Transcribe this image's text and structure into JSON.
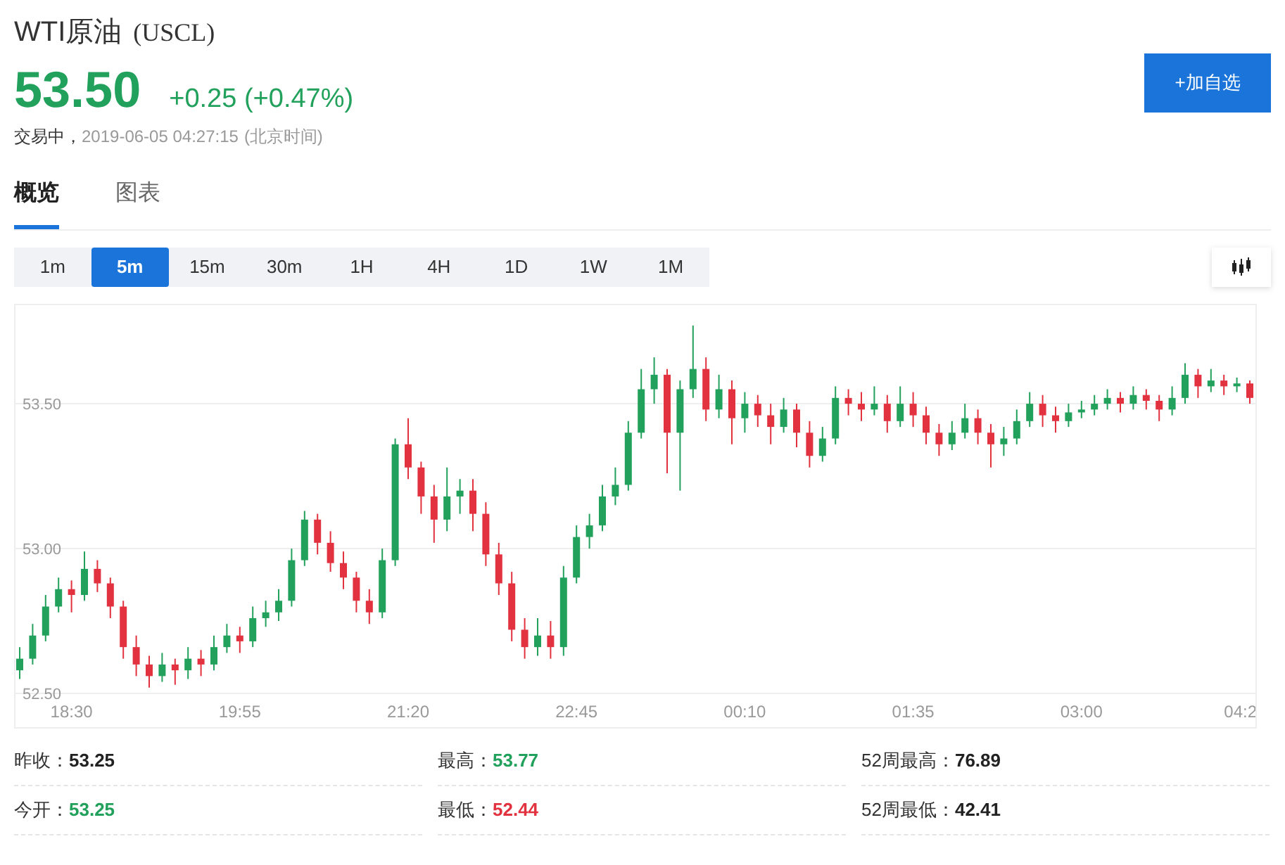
{
  "header": {
    "name": "WTI原油",
    "symbol": "(USCL)",
    "price": "53.50",
    "change": "+0.25 (+0.47%)",
    "color": "#21a15b",
    "status": "交易中，",
    "timestamp": "2019-06-05 04:27:15",
    "timezone": "(北京时间)"
  },
  "watch_button": "+加自选",
  "tabs": [
    {
      "label": "概览",
      "selected": true
    },
    {
      "label": "图表",
      "selected": false
    }
  ],
  "intervals": [
    {
      "label": "1m",
      "selected": false
    },
    {
      "label": "5m",
      "selected": true
    },
    {
      "label": "15m",
      "selected": false
    },
    {
      "label": "30m",
      "selected": false
    },
    {
      "label": "1H",
      "selected": false
    },
    {
      "label": "4H",
      "selected": false
    },
    {
      "label": "1D",
      "selected": false
    },
    {
      "label": "1W",
      "selected": false
    },
    {
      "label": "1M",
      "selected": false
    }
  ],
  "chart": {
    "chart_data": {
      "type": "candlestick",
      "categories": [
        null,
        null,
        null,
        null,
        "18:30",
        null,
        null,
        null,
        null,
        null,
        null,
        null,
        null,
        null,
        null,
        null,
        null,
        "19:55",
        null,
        null,
        null,
        null,
        null,
        null,
        null,
        null,
        null,
        null,
        null,
        null,
        "21:20",
        null,
        null,
        null,
        null,
        null,
        null,
        null,
        null,
        null,
        null,
        null,
        null,
        "22:45",
        null,
        null,
        null,
        null,
        null,
        null,
        null,
        null,
        null,
        null,
        null,
        null,
        "00:10",
        null,
        null,
        null,
        null,
        null,
        null,
        null,
        null,
        null,
        null,
        null,
        null,
        "01:35",
        null,
        null,
        null,
        null,
        null,
        null,
        null,
        null,
        null,
        null,
        null,
        null,
        "03:00",
        null,
        null,
        null,
        null,
        null,
        null,
        null,
        null,
        null,
        null,
        null,
        null,
        "04:2"
      ],
      "ohlc": [
        [
          52.58,
          52.66,
          52.55,
          52.62
        ],
        [
          52.62,
          52.74,
          52.6,
          52.7
        ],
        [
          52.7,
          52.84,
          52.68,
          52.8
        ],
        [
          52.8,
          52.9,
          52.78,
          52.86
        ],
        [
          52.86,
          52.89,
          52.78,
          52.84
        ],
        [
          52.84,
          52.99,
          52.82,
          52.93
        ],
        [
          52.93,
          52.96,
          52.85,
          52.88
        ],
        [
          52.88,
          52.9,
          52.76,
          52.8
        ],
        [
          52.8,
          52.82,
          52.62,
          52.66
        ],
        [
          52.66,
          52.7,
          52.56,
          52.6
        ],
        [
          52.6,
          52.63,
          52.52,
          52.56
        ],
        [
          52.56,
          52.64,
          52.54,
          52.6
        ],
        [
          52.6,
          52.62,
          52.53,
          52.58
        ],
        [
          52.58,
          52.66,
          52.55,
          52.62
        ],
        [
          52.62,
          52.65,
          52.56,
          52.6
        ],
        [
          52.6,
          52.7,
          52.58,
          52.66
        ],
        [
          52.66,
          52.74,
          52.64,
          52.7
        ],
        [
          52.7,
          52.73,
          52.64,
          52.68
        ],
        [
          52.68,
          52.8,
          52.66,
          52.76
        ],
        [
          52.76,
          52.82,
          52.73,
          52.78
        ],
        [
          52.78,
          52.86,
          52.75,
          52.82
        ],
        [
          52.82,
          53.0,
          52.8,
          52.96
        ],
        [
          52.96,
          53.13,
          52.94,
          53.1
        ],
        [
          53.1,
          53.12,
          52.98,
          53.02
        ],
        [
          53.02,
          53.06,
          52.92,
          52.95
        ],
        [
          52.95,
          52.99,
          52.86,
          52.9
        ],
        [
          52.9,
          52.92,
          52.78,
          52.82
        ],
        [
          52.82,
          52.86,
          52.74,
          52.78
        ],
        [
          52.78,
          53.0,
          52.76,
          52.96
        ],
        [
          52.96,
          53.38,
          52.94,
          53.36
        ],
        [
          53.36,
          53.45,
          53.24,
          53.28
        ],
        [
          53.28,
          53.3,
          53.12,
          53.18
        ],
        [
          53.18,
          53.22,
          53.02,
          53.1
        ],
        [
          53.1,
          53.28,
          53.06,
          53.18
        ],
        [
          53.18,
          53.24,
          53.12,
          53.2
        ],
        [
          53.2,
          53.24,
          53.06,
          53.12
        ],
        [
          53.12,
          53.16,
          52.94,
          52.98
        ],
        [
          52.98,
          53.02,
          52.84,
          52.88
        ],
        [
          52.88,
          52.92,
          52.68,
          52.72
        ],
        [
          52.72,
          52.76,
          52.62,
          52.66
        ],
        [
          52.66,
          52.76,
          52.63,
          52.7
        ],
        [
          52.7,
          52.75,
          52.62,
          52.66
        ],
        [
          52.66,
          52.94,
          52.63,
          52.9
        ],
        [
          52.9,
          53.08,
          52.88,
          53.04
        ],
        [
          53.04,
          53.12,
          53.0,
          53.08
        ],
        [
          53.08,
          53.22,
          53.06,
          53.18
        ],
        [
          53.18,
          53.28,
          53.15,
          53.22
        ],
        [
          53.22,
          53.44,
          53.2,
          53.4
        ],
        [
          53.4,
          53.62,
          53.38,
          53.55
        ],
        [
          53.55,
          53.66,
          53.5,
          53.6
        ],
        [
          53.6,
          53.62,
          53.26,
          53.4
        ],
        [
          53.4,
          53.58,
          53.2,
          53.55
        ],
        [
          53.55,
          53.77,
          53.52,
          53.62
        ],
        [
          53.62,
          53.66,
          53.44,
          53.48
        ],
        [
          53.48,
          53.6,
          53.45,
          53.55
        ],
        [
          53.55,
          53.58,
          53.36,
          53.45
        ],
        [
          53.45,
          53.54,
          53.4,
          53.5
        ],
        [
          53.5,
          53.53,
          53.42,
          53.46
        ],
        [
          53.46,
          53.5,
          53.36,
          53.42
        ],
        [
          53.42,
          53.52,
          53.4,
          53.48
        ],
        [
          53.48,
          53.5,
          53.35,
          53.4
        ],
        [
          53.4,
          53.44,
          53.28,
          53.32
        ],
        [
          53.32,
          53.42,
          53.3,
          53.38
        ],
        [
          53.38,
          53.56,
          53.36,
          53.52
        ],
        [
          53.52,
          53.55,
          53.46,
          53.5
        ],
        [
          53.5,
          53.54,
          53.44,
          53.48
        ],
        [
          53.48,
          53.56,
          53.46,
          53.5
        ],
        [
          53.5,
          53.53,
          53.4,
          53.44
        ],
        [
          53.44,
          53.56,
          53.42,
          53.5
        ],
        [
          53.5,
          53.54,
          53.42,
          53.46
        ],
        [
          53.46,
          53.49,
          53.36,
          53.4
        ],
        [
          53.4,
          53.43,
          53.32,
          53.36
        ],
        [
          53.36,
          53.44,
          53.34,
          53.4
        ],
        [
          53.4,
          53.5,
          53.38,
          53.45
        ],
        [
          53.45,
          53.48,
          53.36,
          53.4
        ],
        [
          53.4,
          53.43,
          53.28,
          53.36
        ],
        [
          53.36,
          53.42,
          53.32,
          53.38
        ],
        [
          53.38,
          53.48,
          53.36,
          53.44
        ],
        [
          53.44,
          53.54,
          53.42,
          53.5
        ],
        [
          53.5,
          53.53,
          53.42,
          53.46
        ],
        [
          53.46,
          53.49,
          53.4,
          53.44
        ],
        [
          53.44,
          53.5,
          53.42,
          53.47
        ],
        [
          53.47,
          53.51,
          53.45,
          53.48
        ],
        [
          53.48,
          53.53,
          53.46,
          53.5
        ],
        [
          53.5,
          53.55,
          53.48,
          53.52
        ],
        [
          53.52,
          53.54,
          53.47,
          53.5
        ],
        [
          53.5,
          53.56,
          53.48,
          53.53
        ],
        [
          53.53,
          53.55,
          53.48,
          53.51
        ],
        [
          53.51,
          53.53,
          53.44,
          53.48
        ],
        [
          53.48,
          53.56,
          53.46,
          53.52
        ],
        [
          53.52,
          53.64,
          53.5,
          53.6
        ],
        [
          53.6,
          53.62,
          53.52,
          53.56
        ],
        [
          53.56,
          53.62,
          53.54,
          53.58
        ],
        [
          53.58,
          53.6,
          53.53,
          53.56
        ],
        [
          53.56,
          53.59,
          53.54,
          53.57
        ],
        [
          53.57,
          53.58,
          53.5,
          53.52
        ]
      ],
      "ylim": [
        52.374,
        53.84
      ],
      "grid": true,
      "yticks": [
        {
          "value": 53.5,
          "label": "53.50"
        },
        {
          "value": 53.0,
          "label": "53.00"
        },
        {
          "value": 52.5,
          "label": "52.50"
        }
      ]
    }
  },
  "stats": [
    {
      "label": "昨收：",
      "value": "53.25",
      "color": "#222222"
    },
    {
      "label": "最高：",
      "value": "53.77",
      "color": "#21a15b"
    },
    {
      "label": "52周最高：",
      "value": "76.89",
      "color": "#222222"
    },
    {
      "label": "今开：",
      "value": "53.25",
      "color": "#21a15b"
    },
    {
      "label": "最低：",
      "value": "52.44",
      "color": "#e2323f"
    },
    {
      "label": "52周最低：",
      "value": "42.41",
      "color": "#222222"
    }
  ]
}
